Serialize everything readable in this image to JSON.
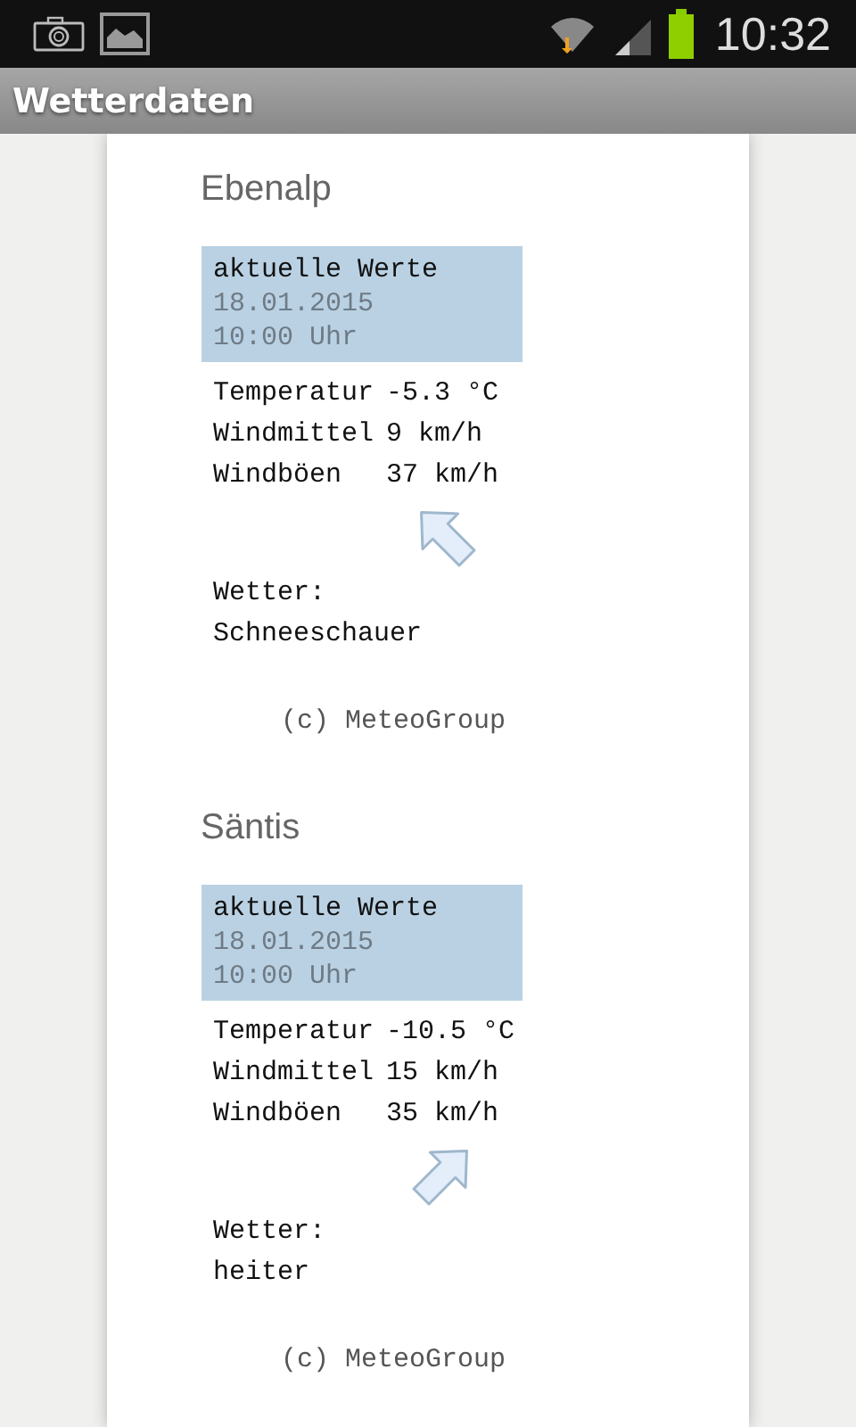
{
  "status_bar": {
    "time": "10:32"
  },
  "app_bar": {
    "title": "Wetterdaten"
  },
  "stations": [
    {
      "name": "Ebenalp",
      "header": {
        "title": "aktuelle Werte",
        "date": "18.01.2015",
        "time": "10:00 Uhr"
      },
      "values": [
        {
          "label": "Temperatur",
          "value": "-5.3 °C"
        },
        {
          "label": "Windmittel",
          "value": "9 km/h"
        },
        {
          "label": "Windböen",
          "value": "37 km/h"
        }
      ],
      "wind_arrow": {
        "kind": "northwest"
      },
      "weather_label": "Wetter:",
      "weather": "Schneeschauer",
      "credit": "(c) MeteoGroup"
    },
    {
      "name": "Säntis",
      "header": {
        "title": "aktuelle Werte",
        "date": "18.01.2015",
        "time": "10:00 Uhr"
      },
      "values": [
        {
          "label": "Temperatur",
          "value": "-10.5 °C"
        },
        {
          "label": "Windmittel",
          "value": "15 km/h"
        },
        {
          "label": "Windböen",
          "value": "35 km/h"
        }
      ],
      "wind_arrow": {
        "kind": "northeast"
      },
      "weather_label": "Wetter:",
      "weather": "heiter",
      "credit": "(c) MeteoGroup"
    }
  ]
}
